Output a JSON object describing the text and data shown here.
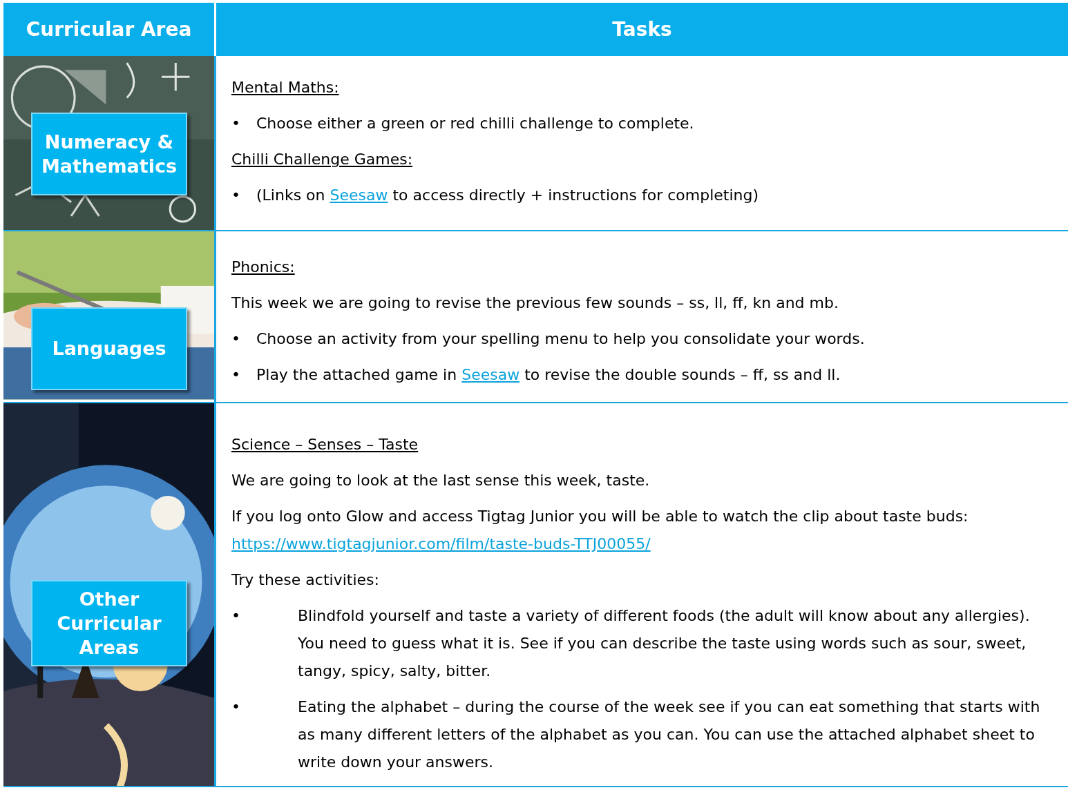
{
  "header": {
    "columns": [
      "Curricular Area",
      "Tasks"
    ]
  },
  "rows": [
    {
      "area": "Numeracy & Mathematics",
      "blocks": [
        {
          "kind": "heading",
          "parts": [
            {
              "kind": "text",
              "text": "Mental Maths:"
            }
          ]
        },
        {
          "kind": "bullet",
          "marker": "•",
          "parts": [
            {
              "kind": "text",
              "text": "Choose either a green or red chilli challenge to complete."
            }
          ]
        },
        {
          "kind": "heading",
          "parts": [
            {
              "kind": "text",
              "text": "Chilli Challenge Games:"
            }
          ]
        },
        {
          "kind": "bullet",
          "marker": "•",
          "parts": [
            {
              "kind": "text",
              "text": "(Links on "
            },
            {
              "kind": "link",
              "text": "Seesaw"
            },
            {
              "kind": "text",
              "text": " to access directly + instructions for completing)"
            }
          ]
        }
      ]
    },
    {
      "area": "Languages",
      "blocks": [
        {
          "kind": "heading",
          "parts": [
            {
              "kind": "text",
              "text": "Phonics:"
            }
          ]
        },
        {
          "kind": "paragraph",
          "parts": [
            {
              "kind": "text",
              "text": "This week we are going to revise the previous few sounds – ss, ll, ff, kn and mb."
            }
          ]
        },
        {
          "kind": "bullet",
          "marker": "•",
          "parts": [
            {
              "kind": "text",
              "text": "Choose an activity from your spelling menu to help you consolidate your words."
            }
          ]
        },
        {
          "kind": "bullet",
          "marker": "•",
          "parts": [
            {
              "kind": "text",
              "text": "Play the attached game in "
            },
            {
              "kind": "link",
              "text": "Seesaw"
            },
            {
              "kind": "text",
              "text": " to revise the double sounds – ff, ss and ll."
            }
          ]
        }
      ]
    },
    {
      "area": "Other Curricular Areas",
      "blocks": [
        {
          "kind": "heading",
          "parts": [
            {
              "kind": "text",
              "text": "Science – Senses – Taste"
            }
          ]
        },
        {
          "kind": "paragraph",
          "parts": [
            {
              "kind": "text",
              "text": "We are going to look at the last sense this week, taste."
            }
          ]
        },
        {
          "kind": "paragraph",
          "parts": [
            {
              "kind": "text",
              "text": "If you log onto Glow and access Tigtag Junior you will be able to watch the clip about taste buds: "
            },
            {
              "kind": "link",
              "text": "https://www.tigtagjunior.com/film/taste-buds-TTJ00055/"
            }
          ]
        },
        {
          "kind": "paragraph",
          "parts": [
            {
              "kind": "text",
              "text": "Try these activities:"
            }
          ]
        },
        {
          "kind": "tab_bullet",
          "marker": "•",
          "parts": [
            {
              "kind": "text",
              "text": "Blindfold yourself and taste a variety of different foods (the adult will know about any allergies). You need to guess what it is. See if you can describe the taste using words such as sour, sweet, tangy, spicy, salty, bitter."
            }
          ]
        },
        {
          "kind": "tab_bullet",
          "marker": "•",
          "parts": [
            {
              "kind": "text",
              "text": "Eating the alphabet – during the course of the week see if you can eat something that starts with as many different letters of the alphabet as you can. You can use the attached alphabet sheet to write down your answers."
            }
          ]
        }
      ]
    }
  ]
}
